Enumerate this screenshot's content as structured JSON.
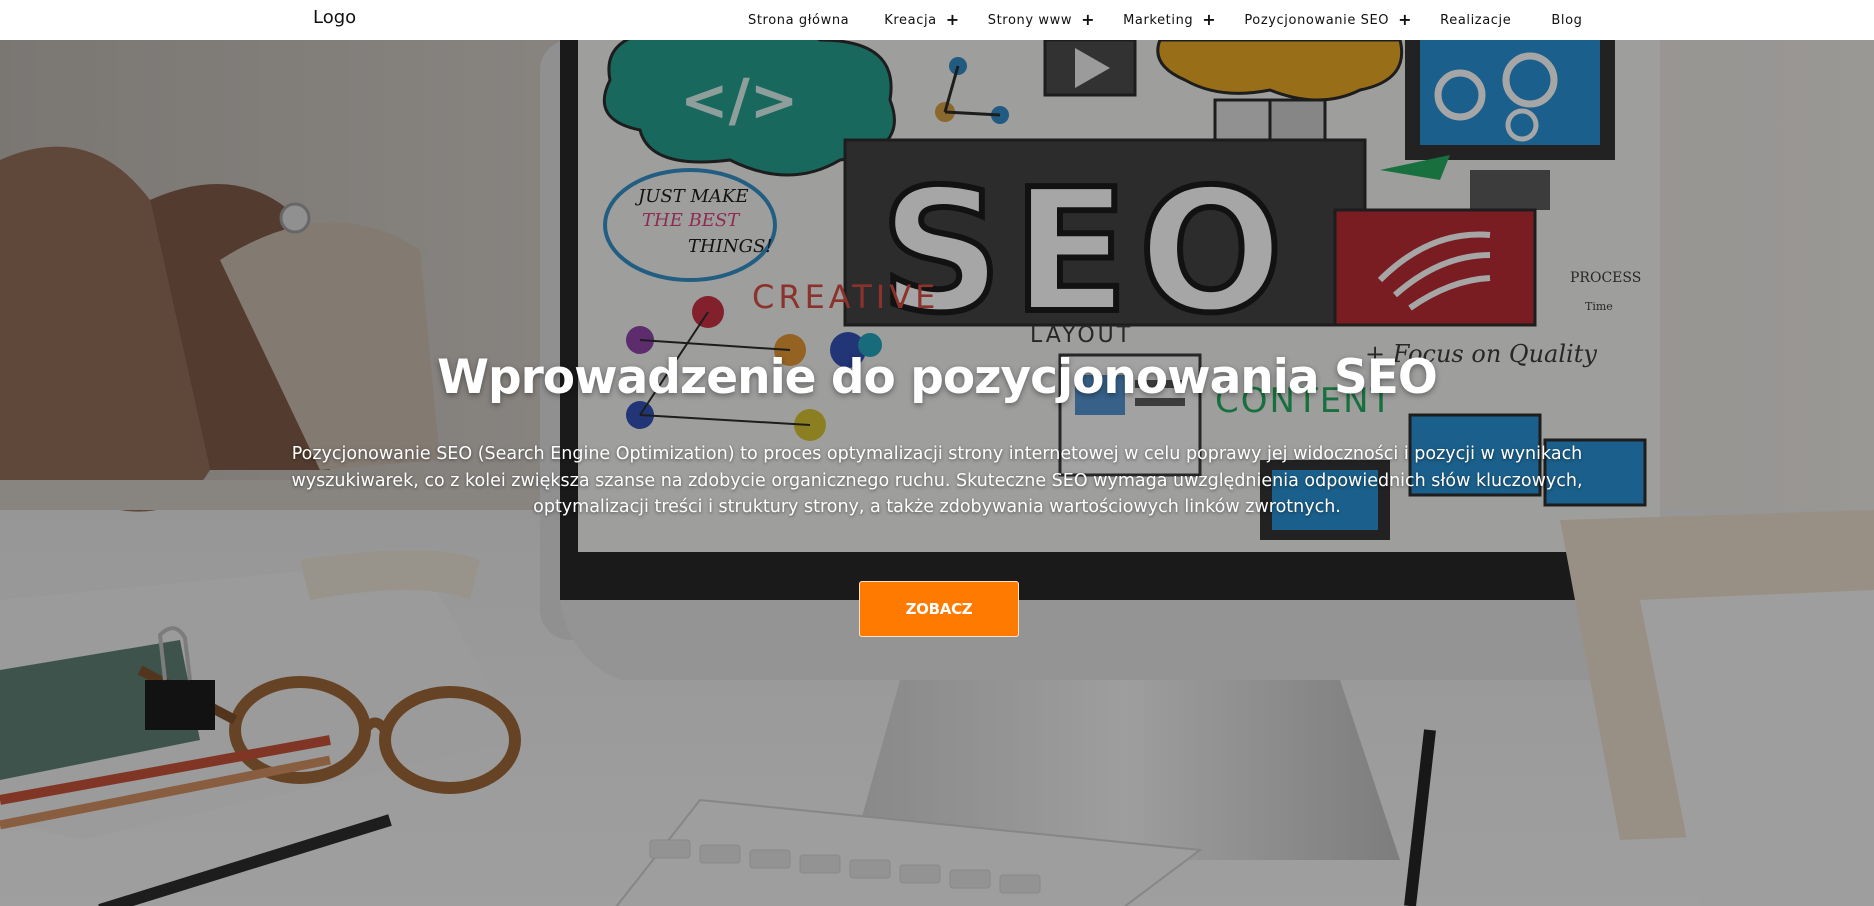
{
  "header": {
    "logo": "Logo",
    "nav": [
      {
        "label": "Strona główna",
        "has_submenu": false
      },
      {
        "label": "Kreacja",
        "has_submenu": true
      },
      {
        "label": "Strony www",
        "has_submenu": true
      },
      {
        "label": "Marketing",
        "has_submenu": true
      },
      {
        "label": "Pozycjonowanie SEO",
        "has_submenu": true
      },
      {
        "label": "Realizacje",
        "has_submenu": false
      },
      {
        "label": "Blog",
        "has_submenu": false
      }
    ],
    "submenu_icon": "plus-icon",
    "submenu_glyph": "+"
  },
  "hero": {
    "title": "Wprowadzenie do pozycjonowania SEO",
    "description": "Pozycjonowanie SEO (Search Engine Optimization) to proces optymalizacji strony internetowej w celu poprawy jej widoczności i pozycji w wynikach wyszukiwarek, co z kolei zwiększa szanse na zdobycie organicznego ruchu. Skuteczne SEO wymaga uwzględnienia odpowiednich słów kluczowych, optymalizacji treści i struktury strony, a także zdobywania wartościowych linków zwrotnych.",
    "button_label": "ZOBACZ",
    "button_color": "#ff7a00",
    "image_words": {
      "seo": "SEO",
      "just_make": "JUST MAKE",
      "the_best": "THE BEST",
      "things": "THINGS!",
      "creative": "CREATIVE",
      "layout": "LAYOUT",
      "focus": "+ Focus on Quality",
      "content": "CONTENT",
      "process": "PROCESS",
      "time": "Time"
    }
  }
}
